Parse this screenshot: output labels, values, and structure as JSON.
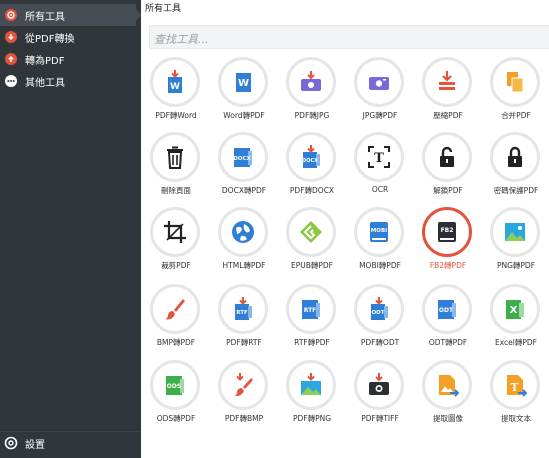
{
  "sidebar": {
    "items": [
      {
        "label": "所有工具",
        "icon": "all-tools-icon",
        "active": true
      },
      {
        "label": "從PDF轉換",
        "icon": "convert-from-pdf-icon",
        "active": false
      },
      {
        "label": "轉為PDF",
        "icon": "convert-to-pdf-icon",
        "active": false
      },
      {
        "label": "其他工具",
        "icon": "more-tools-icon",
        "active": false
      }
    ],
    "settings_label": "設置"
  },
  "main": {
    "title": "所有工具",
    "search_placeholder": "查找工具..."
  },
  "tools": [
    {
      "label": "PDF轉Word",
      "icon": "pdf-to-word-icon"
    },
    {
      "label": "Word轉PDF",
      "icon": "word-to-pdf-icon"
    },
    {
      "label": "PDF轉JPG",
      "icon": "pdf-to-jpg-icon"
    },
    {
      "label": "JPG轉PDF",
      "icon": "jpg-to-pdf-icon"
    },
    {
      "label": "壓縮PDF",
      "icon": "compress-pdf-icon"
    },
    {
      "label": "合并PDF",
      "icon": "merge-pdf-icon"
    },
    {
      "label": "刪除頁面",
      "icon": "trash-icon"
    },
    {
      "label": "DOCX轉PDF",
      "icon": "docx-to-pdf-icon"
    },
    {
      "label": "PDF轉DOCX",
      "icon": "pdf-to-docx-icon"
    },
    {
      "label": "OCR",
      "icon": "ocr-icon"
    },
    {
      "label": "解鎖PDF",
      "icon": "unlock-icon"
    },
    {
      "label": "密碼保護PDF",
      "icon": "lock-icon"
    },
    {
      "label": "裁剪PDF",
      "icon": "crop-icon"
    },
    {
      "label": "HTML轉PDF",
      "icon": "html-to-pdf-icon"
    },
    {
      "label": "EPUB轉PDF",
      "icon": "epub-to-pdf-icon"
    },
    {
      "label": "MOBI轉PDF",
      "icon": "mobi-to-pdf-icon"
    },
    {
      "label": "FB2轉PDF",
      "icon": "fb2-to-pdf-icon",
      "selected": true
    },
    {
      "label": "PNG轉PDF",
      "icon": "png-to-pdf-icon"
    },
    {
      "label": "BMP轉PDF",
      "icon": "bmp-to-pdf-icon"
    },
    {
      "label": "PDF轉RTF",
      "icon": "pdf-to-rtf-icon"
    },
    {
      "label": "RTF轉PDF",
      "icon": "rtf-to-pdf-icon"
    },
    {
      "label": "PDF轉ODT",
      "icon": "pdf-to-odt-icon"
    },
    {
      "label": "ODT轉PDF",
      "icon": "odt-to-pdf-icon"
    },
    {
      "label": "Excel轉PDF",
      "icon": "excel-to-pdf-icon"
    },
    {
      "label": "ODS轉PDF",
      "icon": "ods-to-pdf-icon"
    },
    {
      "label": "PDF轉BMP",
      "icon": "pdf-to-bmp-icon"
    },
    {
      "label": "PDF轉PNG",
      "icon": "pdf-to-png-icon"
    },
    {
      "label": "PDF轉TIFF",
      "icon": "pdf-to-tiff-icon"
    },
    {
      "label": "提取圖像",
      "icon": "extract-images-icon"
    },
    {
      "label": "提取文本",
      "icon": "extract-text-icon"
    }
  ],
  "badges": {
    "docx": "DOCX",
    "rtf": "RTF",
    "odt": "ODT",
    "ods": "ODS",
    "mobi": "MOBI",
    "fb2": "FB2",
    "ocr": "T",
    "excel": "X",
    "word": "W",
    "text": "T"
  },
  "colors": {
    "sidebar_bg": "#31363b",
    "active_bg": "#464c53",
    "accent_red": "#e2543e",
    "word_blue": "#2f7fd6",
    "purple": "#7b68d8",
    "orange": "#f4a024",
    "green": "#3cae4a"
  }
}
